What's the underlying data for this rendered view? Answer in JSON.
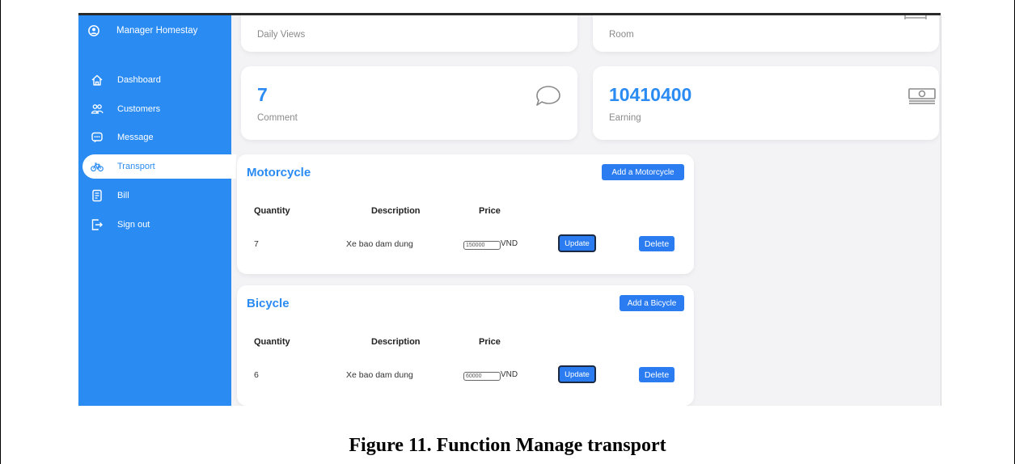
{
  "sidebar": {
    "brand": "Manager Homestay",
    "items": [
      {
        "label": "Dashboard",
        "icon": "home-icon"
      },
      {
        "label": "Customers",
        "icon": "users-icon"
      },
      {
        "label": "Message",
        "icon": "message-icon"
      },
      {
        "label": "Transport",
        "icon": "bicycle-icon",
        "active": true
      },
      {
        "label": "Bill",
        "icon": "bill-icon"
      },
      {
        "label": "Sign out",
        "icon": "sign-out-icon"
      }
    ]
  },
  "stats": {
    "daily_views_label": "Daily Views",
    "room_label": "Room",
    "comment_value": "7",
    "comment_label": "Comment",
    "earning_value": "10410400",
    "earning_label": "Earning"
  },
  "motorcycle": {
    "title": "Motorcycle",
    "add_label": "Add a Motorcycle",
    "headers": {
      "quantity": "Quantity",
      "description": "Description",
      "price": "Price"
    },
    "row": {
      "quantity": "7",
      "description": "Xe bao dam dung",
      "price": "150000",
      "currency": "VND",
      "update": "Update",
      "delete": "Delete"
    }
  },
  "bicycle": {
    "title": "Bicycle",
    "add_label": "Add a Bicycle",
    "headers": {
      "quantity": "Quantity",
      "description": "Description",
      "price": "Price"
    },
    "row": {
      "quantity": "6",
      "description": "Xe bao dam dung",
      "price": "60000",
      "currency": "VND",
      "update": "Update",
      "delete": "Delete"
    }
  },
  "caption": "Figure 11. Function Manage transport",
  "colors": {
    "accent": "#2a8bf2",
    "button": "#2a7cf0",
    "background": "#f3f3f6"
  }
}
